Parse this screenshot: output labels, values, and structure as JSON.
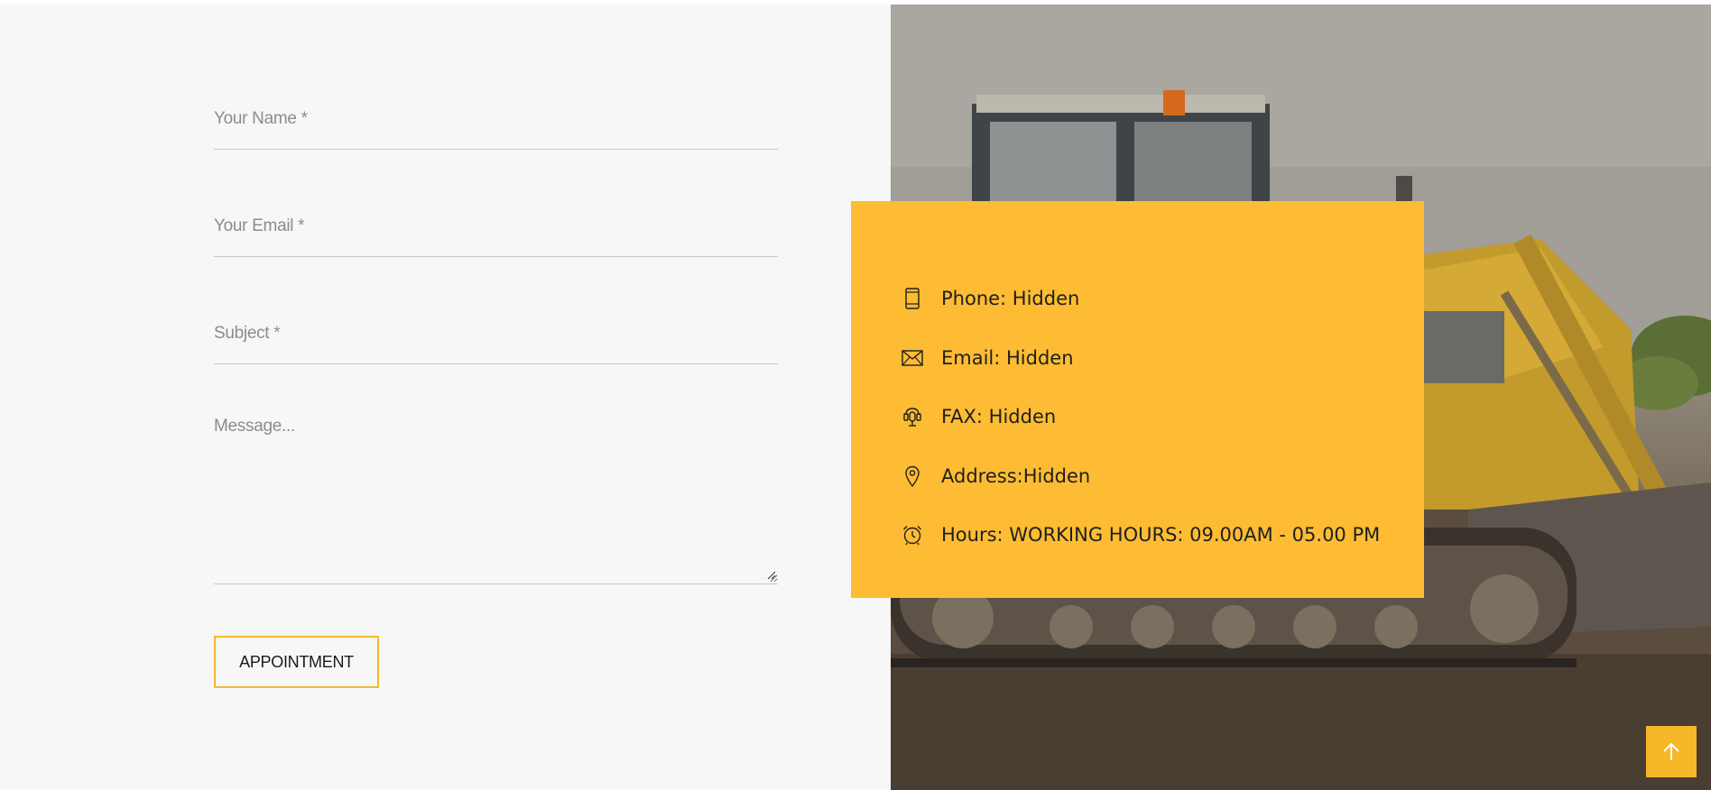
{
  "form": {
    "name_placeholder": "Your Name *",
    "email_placeholder": "Your Email *",
    "subject_placeholder": "Subject *",
    "message_placeholder": "Message...",
    "submit_label": "APPOINTMENT"
  },
  "contact": {
    "items": [
      {
        "icon": "mobile-phone-icon",
        "text": "Phone: Hidden"
      },
      {
        "icon": "envelope-icon",
        "text": "Email: Hidden"
      },
      {
        "icon": "fax-icon",
        "text": "FAX: Hidden"
      },
      {
        "icon": "map-pin-icon",
        "text": "Address:Hidden"
      },
      {
        "icon": "alarm-clock-icon",
        "text": "Hours: WORKING HOURS: 09.00AM - 05.00 PM"
      }
    ]
  },
  "colors": {
    "accent": "#fdbc33",
    "button_border": "#f6b826",
    "panel_bg": "#f7f7f7"
  },
  "back_to_top": {
    "icon": "arrow-up-icon"
  }
}
